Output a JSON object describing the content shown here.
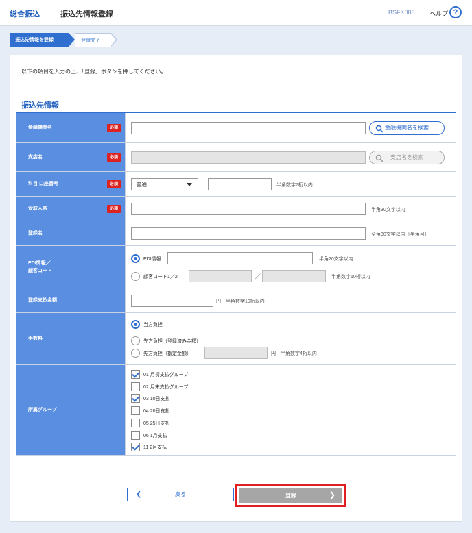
{
  "header": {
    "brand": "総合振込",
    "title": "振込先情報登録",
    "screen_id": "BSFK003",
    "help_label": "ヘルプ",
    "help_icon": "?"
  },
  "steps": [
    {
      "label": "振込先情報を登録",
      "active": true
    },
    {
      "label": "登録完了",
      "active": false
    }
  ],
  "instruction": "以下の項目を入力の上、「登録」ボタンを押してください。",
  "section_title": "振込先情報",
  "required_badge": "必須",
  "form": {
    "bank": {
      "label": "金融機関名",
      "value": "",
      "search_label": "金融機関名を検索"
    },
    "branch": {
      "label": "支店名",
      "value": "",
      "search_label": "支店名を検索"
    },
    "account": {
      "label": "科目 口座番号",
      "type_value": "普通",
      "number_value": "",
      "hint": "半角数字7桁以内"
    },
    "payee": {
      "label": "受取人名",
      "value": "",
      "hint": "半角30文字以内"
    },
    "reg_name": {
      "label": "登録名",
      "value": "",
      "hint": "全角30文字以内［半角可］"
    },
    "edi": {
      "label_line1": "EDI情報／",
      "label_line2": "顧客コード",
      "opt1_label": "EDI情報",
      "opt1_hint": "半角20文字以内",
      "opt2_label": "顧客コード1／2",
      "separator": "／",
      "opt2_hint": "半角数字10桁以内"
    },
    "amount": {
      "label": "登録支払金額",
      "value": "",
      "unit": "円",
      "hint": "半角数字10桁以内"
    },
    "fee": {
      "label": "手数料",
      "opt1": "当方負担",
      "opt2": "先方負担（登録済み金額）",
      "opt3": "先方負担（指定金額）",
      "unit": "円",
      "hint": "半角数字4桁以内"
    },
    "group": {
      "label": "所属グループ",
      "items": [
        {
          "label": "01 月初支払グループ",
          "checked": true
        },
        {
          "label": "02 月末支払グループ",
          "checked": false
        },
        {
          "label": "03 10日支払",
          "checked": true
        },
        {
          "label": "04 20日支払",
          "checked": false
        },
        {
          "label": "05 25日支払",
          "checked": false
        },
        {
          "label": "06 1月支払",
          "checked": false
        },
        {
          "label": "11 2月支払",
          "checked": true
        }
      ]
    }
  },
  "buttons": {
    "back": "戻る",
    "register": "登録"
  }
}
